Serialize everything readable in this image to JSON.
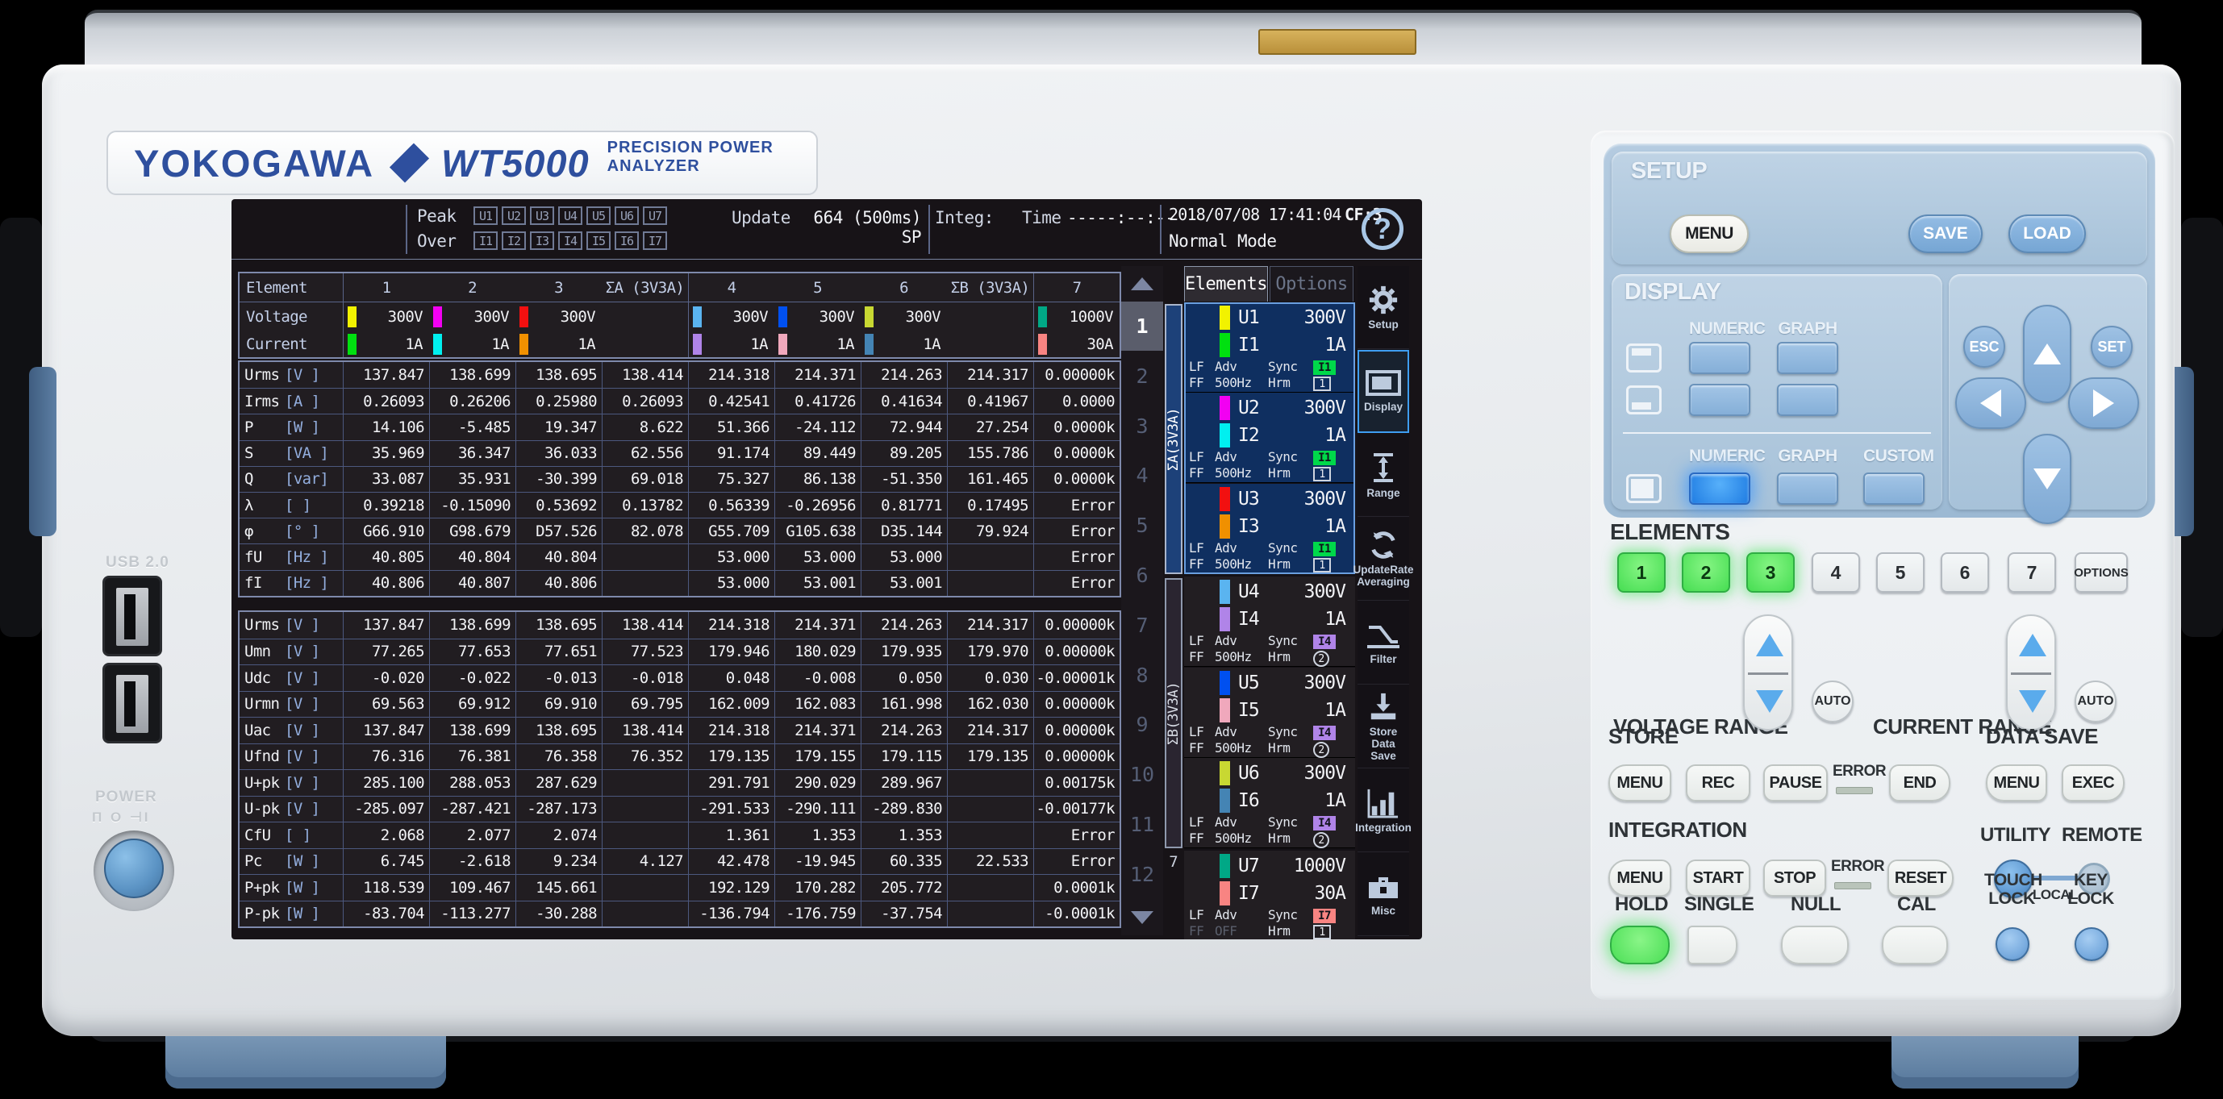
{
  "device": {
    "brand": "YOKOGAWA",
    "model": "WT5000",
    "subtitle": "PRECISION POWER ANALYZER",
    "usb_label": "USB 2.0",
    "power_label": "POWER",
    "power_symbols": "Π O ⊣I"
  },
  "header": {
    "peak_label": "Peak",
    "over_label": "Over",
    "peak_badges": [
      "U1",
      "U2",
      "U3",
      "U4",
      "U5",
      "U6",
      "U7"
    ],
    "over_badges": [
      "I1",
      "I2",
      "I3",
      "I4",
      "I5",
      "I6",
      "I7"
    ],
    "update_label": "Update",
    "update_value": "664 (500ms) SP",
    "integ_label": "Integ:",
    "time_label": "Time",
    "time_value": "-----:--:--",
    "datetime": "2018/07/08 17:41:04",
    "cf": "CF:3",
    "mode": "Normal Mode",
    "help_icon": "?"
  },
  "table": {
    "element_label": "Element",
    "columns": [
      "1",
      "2",
      "3",
      "ΣA (3V3A)",
      "4",
      "5",
      "6",
      "ΣB (3V3A)",
      "7"
    ],
    "voltage_label": "Voltage",
    "voltage_values": [
      "300V",
      "300V",
      "300V",
      "",
      "300V",
      "300V",
      "300V",
      "",
      "1000V"
    ],
    "voltage_colors": [
      "#f2f200",
      "#f200f2",
      "#f21010",
      "",
      "#5ab4f0",
      "#0050f0",
      "#c8d832",
      "",
      "#00a886"
    ],
    "current_label": "Current",
    "current_values": [
      "1A",
      "1A",
      "1A",
      "",
      "1A",
      "1A",
      "1A",
      "",
      "30A"
    ],
    "current_colors": [
      "#00e010",
      "#00f0f0",
      "#f09000",
      "",
      "#b084e8",
      "#f0a8bc",
      "#4484b4",
      "",
      "#f88482"
    ],
    "block1": [
      {
        "name": "Urms",
        "unit": "[V  ]",
        "values": [
          "137.847",
          "138.699",
          "138.695",
          "138.414",
          "214.318",
          "214.371",
          "214.263",
          "214.317",
          "0.00000k"
        ]
      },
      {
        "name": "Irms",
        "unit": "[A  ]",
        "values": [
          "0.26093",
          "0.26206",
          "0.25980",
          "0.26093",
          "0.42541",
          "0.41726",
          "0.41634",
          "0.41967",
          "0.0000"
        ]
      },
      {
        "name": "P",
        "unit": "[W  ]",
        "values": [
          "14.106",
          "-5.485",
          "19.347",
          "8.622",
          "51.366",
          "-24.112",
          "72.944",
          "27.254",
          "0.0000k"
        ]
      },
      {
        "name": "S",
        "unit": "[VA ]",
        "values": [
          "35.969",
          "36.347",
          "36.033",
          "62.556",
          "91.174",
          "89.449",
          "89.205",
          "155.786",
          "0.0000k"
        ]
      },
      {
        "name": "Q",
        "unit": "[var]",
        "values": [
          "33.087",
          "35.931",
          "-30.399",
          "69.018",
          "75.327",
          "86.138",
          "-51.350",
          "161.465",
          "0.0000k"
        ]
      },
      {
        "name": "λ",
        "unit": "[   ]",
        "values": [
          "0.39218",
          "-0.15090",
          "0.53692",
          "0.13782",
          "0.56339",
          "-0.26956",
          "0.81771",
          "0.17495",
          "Error"
        ]
      },
      {
        "name": "φ",
        "unit": "[°  ]",
        "values": [
          "G66.910",
          "G98.679",
          "D57.526",
          "82.078",
          "G55.709",
          "G105.638",
          "D35.144",
          "79.924",
          "Error"
        ]
      },
      {
        "name": "fU",
        "unit": "[Hz ]",
        "values": [
          "40.805",
          "40.804",
          "40.804",
          "",
          "53.000",
          "53.000",
          "53.000",
          "",
          "Error"
        ]
      },
      {
        "name": "fI",
        "unit": "[Hz ]",
        "values": [
          "40.806",
          "40.807",
          "40.806",
          "",
          "53.000",
          "53.001",
          "53.001",
          "",
          "Error"
        ]
      }
    ],
    "block2": [
      {
        "name": "Urms",
        "unit": "[V  ]",
        "values": [
          "137.847",
          "138.699",
          "138.695",
          "138.414",
          "214.318",
          "214.371",
          "214.263",
          "214.317",
          "0.00000k"
        ]
      },
      {
        "name": "Umn",
        "unit": "[V  ]",
        "values": [
          "77.265",
          "77.653",
          "77.651",
          "77.523",
          "179.946",
          "180.029",
          "179.935",
          "179.970",
          "0.00000k"
        ]
      },
      {
        "name": "Udc",
        "unit": "[V  ]",
        "values": [
          "-0.020",
          "-0.022",
          "-0.013",
          "-0.018",
          "0.048",
          "-0.008",
          "0.050",
          "0.030",
          "-0.00001k"
        ]
      },
      {
        "name": "Urmn",
        "unit": "[V  ]",
        "values": [
          "69.563",
          "69.912",
          "69.910",
          "69.795",
          "162.009",
          "162.083",
          "161.998",
          "162.030",
          "0.00000k"
        ]
      },
      {
        "name": "Uac",
        "unit": "[V  ]",
        "values": [
          "137.847",
          "138.699",
          "138.695",
          "138.414",
          "214.318",
          "214.371",
          "214.263",
          "214.317",
          "0.00000k"
        ]
      },
      {
        "name": "Ufnd",
        "unit": "[V  ]",
        "values": [
          "76.316",
          "76.381",
          "76.358",
          "76.352",
          "179.135",
          "179.155",
          "179.115",
          "179.135",
          "0.00000k"
        ]
      },
      {
        "name": "U+pk",
        "unit": "[V  ]",
        "values": [
          "285.100",
          "288.053",
          "287.629",
          "",
          "291.791",
          "290.029",
          "289.967",
          "",
          "0.00175k"
        ]
      },
      {
        "name": "U-pk",
        "unit": "[V  ]",
        "values": [
          "-285.097",
          "-287.421",
          "-287.173",
          "",
          "-291.533",
          "-290.111",
          "-289.830",
          "",
          "-0.00177k"
        ]
      },
      {
        "name": "CfU",
        "unit": "[   ]",
        "values": [
          "2.068",
          "2.077",
          "2.074",
          "",
          "1.361",
          "1.353",
          "1.353",
          "",
          "Error"
        ]
      },
      {
        "name": "Pc",
        "unit": "[W  ]",
        "values": [
          "6.745",
          "-2.618",
          "9.234",
          "4.127",
          "42.478",
          "-19.945",
          "60.335",
          "22.533",
          "Error"
        ]
      },
      {
        "name": "P+pk",
        "unit": "[W  ]",
        "values": [
          "118.539",
          "109.467",
          "145.661",
          "",
          "192.129",
          "170.282",
          "205.772",
          "",
          "0.0001k"
        ]
      },
      {
        "name": "P-pk",
        "unit": "[W  ]",
        "values": [
          "-83.704",
          "-113.277",
          "-30.288",
          "",
          "-136.794",
          "-176.759",
          "-37.754",
          "",
          "-0.0001k"
        ]
      }
    ]
  },
  "pages": {
    "items": [
      "1",
      "2",
      "3",
      "4",
      "5",
      "6",
      "7",
      "8",
      "9",
      "10",
      "11",
      "12"
    ],
    "active": "1"
  },
  "sidebar": {
    "tabs": [
      {
        "label": "Elements",
        "active": true
      },
      {
        "label": "Options",
        "active": false
      }
    ],
    "groups": [
      {
        "label": "ΣA(3V3A)"
      },
      {
        "label": "ΣB(3V3A)"
      },
      {
        "label": "7"
      }
    ],
    "elements": [
      {
        "u": "U1",
        "u_range": "300V",
        "u_color": "#f2f200",
        "i": "I1",
        "i_range": "1A",
        "i_color": "#00e010",
        "lf": "LF",
        "ff": "FF",
        "adv": "Adv",
        "freq": "500Hz",
        "sync": "Sync",
        "hrm": "Hrm",
        "sync_badge": "I1",
        "sync_color": "#00d84a",
        "hrm_badge": "1",
        "hrm_style": "box",
        "ff_off": false
      },
      {
        "u": "U2",
        "u_range": "300V",
        "u_color": "#f200f2",
        "i": "I2",
        "i_range": "1A",
        "i_color": "#00f0f0",
        "lf": "LF",
        "ff": "FF",
        "adv": "Adv",
        "freq": "500Hz",
        "sync": "Sync",
        "hrm": "Hrm",
        "sync_badge": "I1",
        "sync_color": "#00d84a",
        "hrm_badge": "1",
        "hrm_style": "box",
        "ff_off": false
      },
      {
        "u": "U3",
        "u_range": "300V",
        "u_color": "#f21010",
        "i": "I3",
        "i_range": "1A",
        "i_color": "#f09000",
        "lf": "LF",
        "ff": "FF",
        "adv": "Adv",
        "freq": "500Hz",
        "sync": "Sync",
        "hrm": "Hrm",
        "sync_badge": "I1",
        "sync_color": "#00d84a",
        "hrm_badge": "1",
        "hrm_style": "box",
        "ff_off": false
      },
      {
        "u": "U4",
        "u_range": "300V",
        "u_color": "#5ab4f0",
        "i": "I4",
        "i_range": "1A",
        "i_color": "#b084e8",
        "lf": "LF",
        "ff": "FF",
        "adv": "Adv",
        "freq": "500Hz",
        "sync": "Sync",
        "hrm": "Hrm",
        "sync_badge": "I4",
        "sync_color": "#b084e8",
        "hrm_badge": "2",
        "hrm_style": "circle",
        "ff_off": false
      },
      {
        "u": "U5",
        "u_range": "300V",
        "u_color": "#0050f0",
        "i": "I5",
        "i_range": "1A",
        "i_color": "#f0a8bc",
        "lf": "LF",
        "ff": "FF",
        "adv": "Adv",
        "freq": "500Hz",
        "sync": "Sync",
        "hrm": "Hrm",
        "sync_badge": "I4",
        "sync_color": "#b084e8",
        "hrm_badge": "2",
        "hrm_style": "circle",
        "ff_off": false
      },
      {
        "u": "U6",
        "u_range": "300V",
        "u_color": "#c8d832",
        "i": "I6",
        "i_range": "1A",
        "i_color": "#4484b4",
        "lf": "LF",
        "ff": "FF",
        "adv": "Adv",
        "freq": "500Hz",
        "sync": "Sync",
        "hrm": "Hrm",
        "sync_badge": "I4",
        "sync_color": "#b084e8",
        "hrm_badge": "2",
        "hrm_style": "circle",
        "ff_off": false
      },
      {
        "u": "U7",
        "u_range": "1000V",
        "u_color": "#00a886",
        "i": "I7",
        "i_range": "30A",
        "i_color": "#f88482",
        "lf": "LF",
        "ff": "FF",
        "adv": "Adv",
        "freq": "OFF",
        "sync": "Sync",
        "hrm": "Hrm",
        "sync_badge": "I7",
        "sync_color": "#f88482",
        "hrm_badge": "1",
        "hrm_style": "box",
        "ff_off": true
      }
    ]
  },
  "menu": {
    "items": [
      {
        "label": "Setup",
        "icon": "gear",
        "active": false
      },
      {
        "label": "Display",
        "icon": "display",
        "active": true
      },
      {
        "label": "Range",
        "icon": "range",
        "active": false
      },
      {
        "label": "UpdateRate\nAveraging",
        "icon": "update",
        "active": false
      },
      {
        "label": "Filter",
        "icon": "filter",
        "active": false
      },
      {
        "label": "Store\nData Save",
        "icon": "store",
        "active": false
      },
      {
        "label": "Integration",
        "icon": "integration",
        "active": false
      },
      {
        "label": "Misc",
        "icon": "misc",
        "active": false
      }
    ]
  },
  "panel": {
    "setup": {
      "title": "SETUP",
      "menu": "MENU",
      "save": "SAVE",
      "load": "LOAD"
    },
    "display": {
      "title": "DISPLAY",
      "numeric_top": "NUMERIC",
      "graph_top": "GRAPH",
      "numeric": "NUMERIC",
      "graph": "GRAPH",
      "custom": "CUSTOM",
      "esc": "ESC",
      "set": "SET"
    },
    "elements": {
      "title": "ELEMENTS",
      "buttons": [
        "1",
        "2",
        "3",
        "4",
        "5",
        "6",
        "7"
      ],
      "lit": [
        "1",
        "2",
        "3"
      ],
      "options": "OPTIONS"
    },
    "voltage_range": "VOLTAGE RANGE",
    "current_range": "CURRENT RANGE",
    "auto": "AUTO",
    "store": {
      "title": "STORE",
      "menu": "MENU",
      "rec": "REC",
      "pause": "PAUSE",
      "error": "ERROR",
      "end": "END"
    },
    "data_save": {
      "title": "DATA SAVE",
      "menu": "MENU",
      "exec": "EXEC"
    },
    "integration": {
      "title": "INTEGRATION",
      "menu": "MENU",
      "start": "START",
      "stop": "STOP",
      "error": "ERROR",
      "reset": "RESET"
    },
    "utility": "UTILITY",
    "remote": "REMOTE",
    "local": "LOCAL",
    "hold": "HOLD",
    "single": "SINGLE",
    "null": "NULL",
    "cal": "CAL",
    "touch_lock": "TOUCH\nLOCK",
    "key_lock": "KEY\nLOCK"
  }
}
